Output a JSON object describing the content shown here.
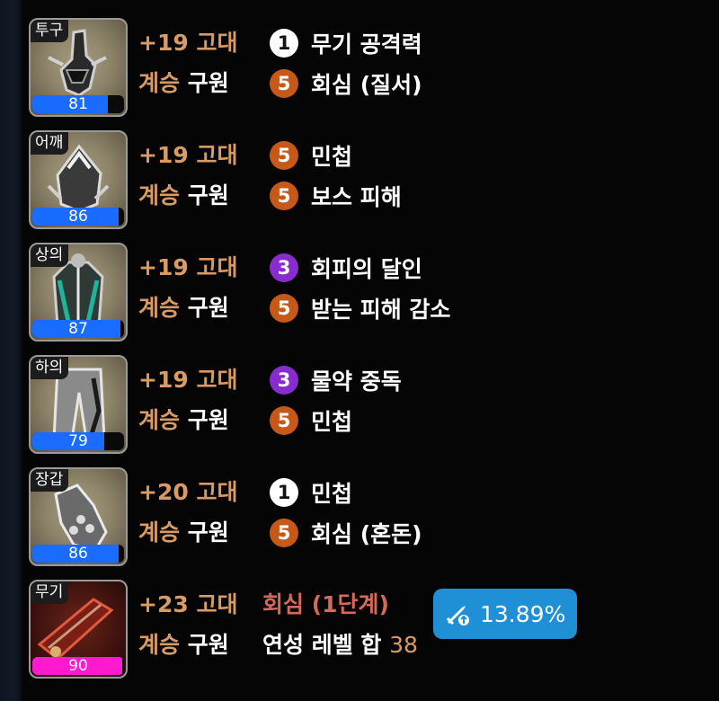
{
  "rows": [
    {
      "slot": "투구",
      "level": 81,
      "level_pct": 0.82,
      "enhance": "+19 고대",
      "set_a": "계승",
      "set_b": "구원",
      "effects": [
        {
          "tier": "1",
          "name": "무기 공격력"
        },
        {
          "tier": "5",
          "name": "회심 (질서)"
        }
      ]
    },
    {
      "slot": "어깨",
      "level": 86,
      "level_pct": 0.94,
      "enhance": "+19 고대",
      "set_a": "계승",
      "set_b": "구원",
      "effects": [
        {
          "tier": "5",
          "name": "민첩"
        },
        {
          "tier": "5",
          "name": "보스 피해"
        }
      ]
    },
    {
      "slot": "상의",
      "level": 87,
      "level_pct": 0.96,
      "enhance": "+19 고대",
      "set_a": "계승",
      "set_b": "구원",
      "effects": [
        {
          "tier": "3",
          "name": "회피의 달인"
        },
        {
          "tier": "5",
          "name": "받는 피해 감소"
        }
      ]
    },
    {
      "slot": "하의",
      "level": 79,
      "level_pct": 0.78,
      "enhance": "+19 고대",
      "set_a": "계승",
      "set_b": "구원",
      "effects": [
        {
          "tier": "3",
          "name": "물약 중독"
        },
        {
          "tier": "5",
          "name": "민첩"
        }
      ]
    },
    {
      "slot": "장갑",
      "level": 86,
      "level_pct": 0.94,
      "enhance": "+20 고대",
      "set_a": "계승",
      "set_b": "구원",
      "effects": [
        {
          "tier": "1",
          "name": "민첩"
        },
        {
          "tier": "5",
          "name": "회심 (혼돈)"
        }
      ]
    }
  ],
  "weapon": {
    "slot": "무기",
    "level": 90,
    "level_pct": 0.98,
    "enhance": "+23 고대",
    "set_a": "계승",
    "set_b": "구원",
    "crit_stage": "회심 (1단계)",
    "refine_label": "연성 레벨 합",
    "refine_value": "38",
    "dps_icon": "sword-upgrade-icon",
    "dps_value": "13.89%"
  },
  "colors": {
    "gold": "#d99b63",
    "tier1": "#ffffff",
    "tier3": "#8a2bd0",
    "tier5": "#c65818",
    "armor_bar": "#1a6cff",
    "weapon_bar": "#ff1ad0",
    "dps_box": "#1f8fd6"
  }
}
